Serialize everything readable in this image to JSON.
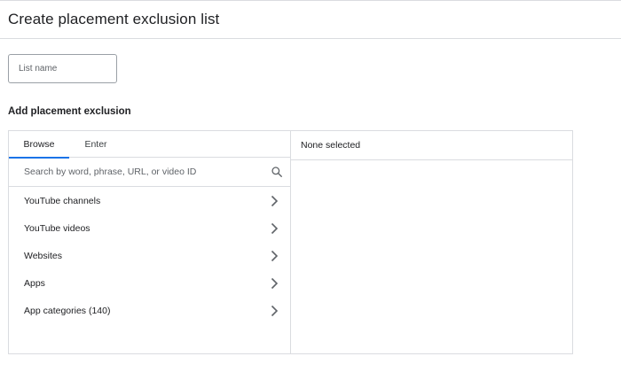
{
  "page": {
    "title": "Create placement exclusion list"
  },
  "list_name": {
    "placeholder": "List name",
    "value": ""
  },
  "section": {
    "title": "Add placement exclusion"
  },
  "tabs": [
    {
      "label": "Browse",
      "active": true
    },
    {
      "label": "Enter",
      "active": false
    }
  ],
  "search": {
    "placeholder": "Search by word, phrase, URL, or video ID",
    "icon": "search-icon"
  },
  "browse_items": [
    {
      "label": "YouTube channels",
      "icon": "chevron-right-icon"
    },
    {
      "label": "YouTube videos",
      "icon": "chevron-right-icon"
    },
    {
      "label": "Websites",
      "icon": "chevron-right-icon"
    },
    {
      "label": "Apps",
      "icon": "chevron-right-icon"
    },
    {
      "label": "App categories (140)",
      "icon": "chevron-right-icon"
    }
  ],
  "selection": {
    "status": "None selected"
  },
  "colors": {
    "accent": "#1a73e8",
    "border": "#dadce0",
    "text": "#202124",
    "muted": "#5f6368"
  }
}
